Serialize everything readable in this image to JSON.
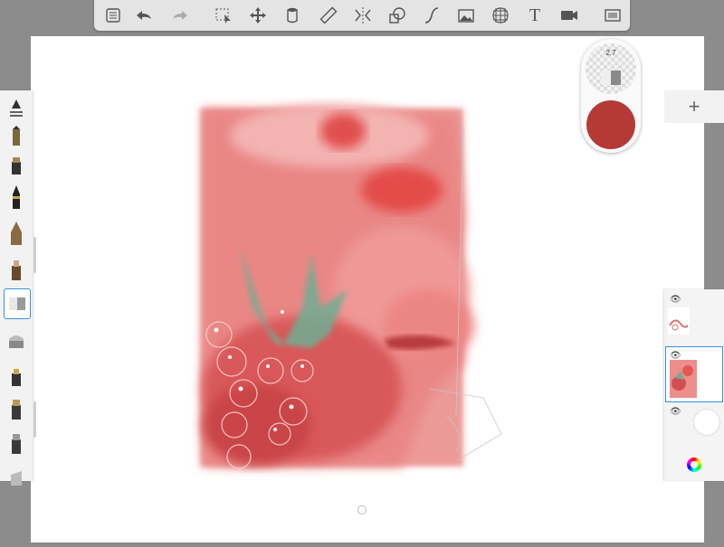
{
  "toolbar": {
    "items": [
      "menu-icon",
      "undo-icon",
      "redo-icon",
      "selection-icon",
      "transform-icon",
      "fill-icon",
      "ruler-icon",
      "symmetry-icon",
      "shapes-icon",
      "curve-icon",
      "image-icon",
      "perspective-icon",
      "text-icon",
      "video-icon",
      "fullscreen-icon"
    ],
    "text_tool_glyph": "T"
  },
  "brush_puck": {
    "size_value": "2.7",
    "color": "#b53a36"
  },
  "brushes": [
    "pencil",
    "marker",
    "pen",
    "ballpoint",
    "brush",
    "eraser",
    "airbrush",
    "paintbrush",
    "ink",
    "chalk",
    "smudge"
  ],
  "layers": {
    "add_label": "+",
    "eye_glyph": "👁"
  },
  "colors": {
    "accent": "#3b8ee0",
    "paint_red": "#e05a58"
  }
}
